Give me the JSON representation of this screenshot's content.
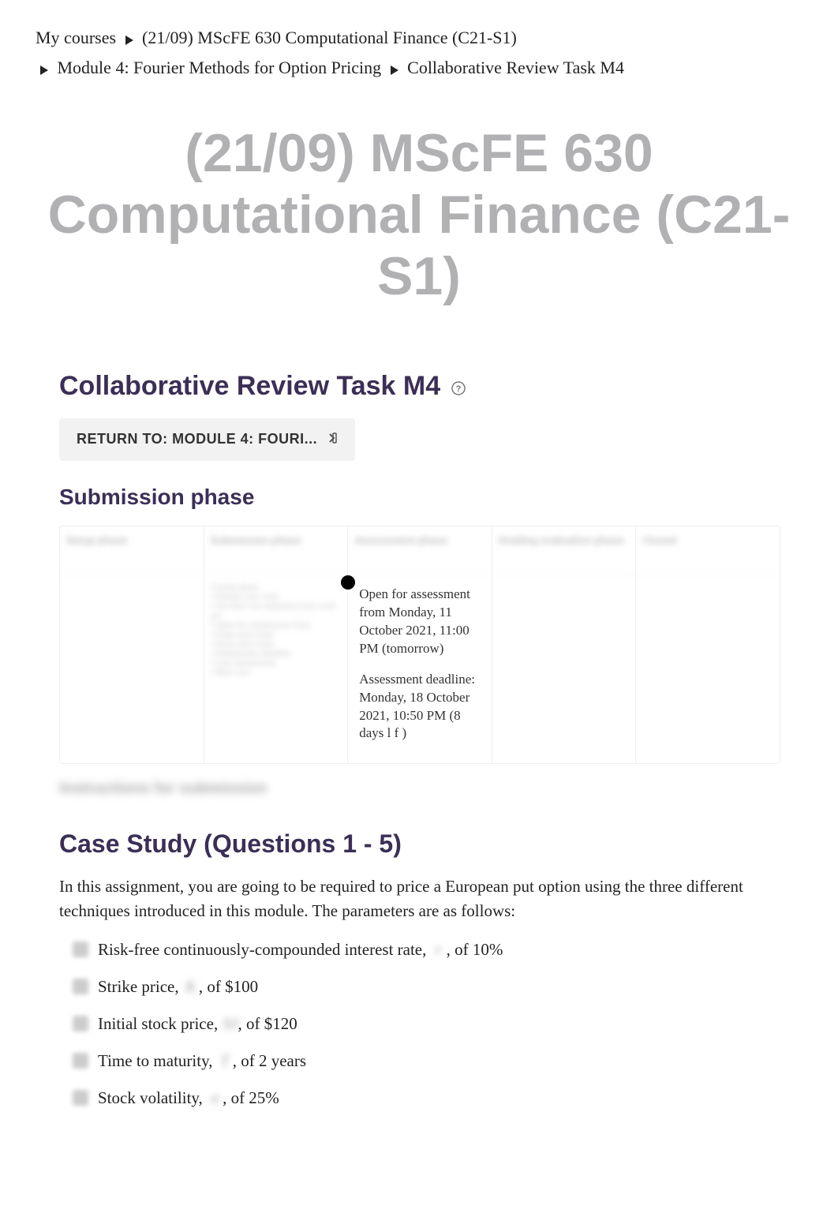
{
  "breadcrumb": {
    "items": [
      "My courses",
      "(21/09) MScFE 630 Computational Finance (C21-S1)",
      "Module 4: Fourier Methods for Option Pricing",
      "Collaborative Review Task M4"
    ]
  },
  "course_title": "(21/09) MScFE 630 Computational Finance (C21-S1)",
  "task_title": "Collaborative Review Task M4",
  "return_button": "RETURN TO: MODULE 4: FOURI...",
  "phase_title": "Submission phase",
  "phases": {
    "headers_blurred": [
      "Setup phase",
      "Submission phase",
      "Assessment phase",
      "Grading evaluation phase",
      "Closed"
    ],
    "assessment": {
      "open_text": "Open for assessment from Monday, 11 October 2021, 11:00 PM (tomorrow)",
      "deadline_text": "Assessment deadline: Monday, 18 October 2021, 10:50 PM (8 days l f )"
    }
  },
  "instructions_blurred": "Instructions for submission",
  "case_title": "Case Study (Questions 1 - 5)",
  "intro": "In this assignment, you are going to be required to price a European put option using the three different techniques introduced in this module. The parameters are as follows:",
  "params": [
    {
      "pre": "Risk-free continuously-compounded interest rate, ",
      "mid": "r",
      "post": ", of 10%"
    },
    {
      "pre": "Strike price, ",
      "mid": "K",
      "post": ", of $100"
    },
    {
      "pre": "Initial stock price, ",
      "mid": "S0",
      "post": ", of $120"
    },
    {
      "pre": "Time to maturity, ",
      "mid": "T",
      "post": ", of 2 years"
    },
    {
      "pre": "Stock volatility, ",
      "mid": "σ",
      "post": ", of 25%"
    }
  ]
}
